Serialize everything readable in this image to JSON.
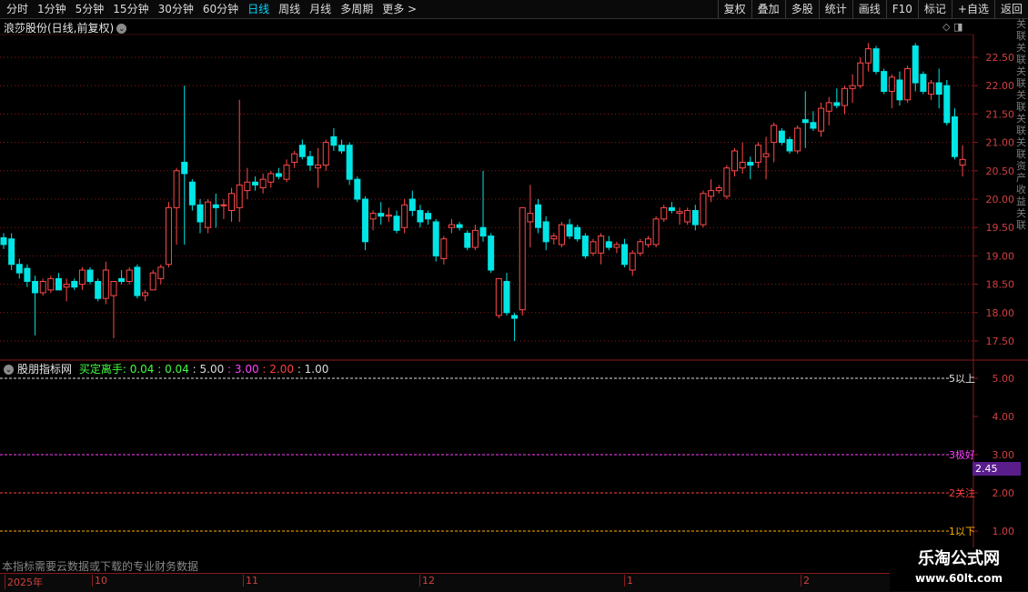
{
  "toolbar": {
    "periods": [
      "分时",
      "1分钟",
      "5分钟",
      "15分钟",
      "30分钟",
      "60分钟",
      "日线",
      "周线",
      "月线",
      "多周期",
      "更多 >"
    ],
    "active_period": "日线",
    "tools": [
      "复权",
      "叠加",
      "多股",
      "统计",
      "画线",
      "F10",
      "标记",
      "+自选",
      "返回"
    ]
  },
  "stock": {
    "title": "浪莎股份(日线,前复权)"
  },
  "main_axis": {
    "ticks": [
      "22.50",
      "22.00",
      "21.50",
      "21.00",
      "20.50",
      "20.00",
      "19.50",
      "19.00",
      "18.50",
      "18.00",
      "17.50"
    ]
  },
  "indicator": {
    "name": "股朋指标网",
    "label": "买定离手:",
    "values": [
      "0.04",
      "0.04",
      "5.00",
      "3.00",
      "2.00",
      "1.00"
    ],
    "value_colors": [
      "#40ff40",
      "#40ff40",
      "#dcdcdc",
      "#ff40ff",
      "#ff4040",
      "#dcdcdc"
    ],
    "axis_ticks": [
      "5.00",
      "4.00",
      "3.00",
      "2.00",
      "1.00"
    ],
    "line_labels": [
      "5以上",
      "3极好",
      "2关注",
      "1以下"
    ],
    "current_value": "2.45"
  },
  "notice": "本指标需要云数据或下载的专业财务数据",
  "time_axis": [
    "2025年",
    "10",
    "11",
    "12",
    "1",
    "2"
  ],
  "watermark": {
    "line1": "乐淘公式网",
    "line2": "www.60lt.com"
  },
  "right_strip_text": "关联关联关联关联关联关联资产收益关联",
  "colors": {
    "up": "#ff4a4a",
    "down": "#00e6e6",
    "grid": "#8b1a1a"
  },
  "chart_data": {
    "type": "candlestick",
    "series": [
      {
        "o": 19.32,
        "h": 19.4,
        "l": 19.12,
        "c": 19.2
      },
      {
        "o": 19.3,
        "h": 19.4,
        "l": 18.75,
        "c": 18.85
      },
      {
        "o": 18.85,
        "h": 18.95,
        "l": 18.6,
        "c": 18.7
      },
      {
        "o": 18.78,
        "h": 18.85,
        "l": 18.45,
        "c": 18.55
      },
      {
        "o": 18.55,
        "h": 18.65,
        "l": 17.6,
        "c": 18.35
      },
      {
        "o": 18.35,
        "h": 18.6,
        "l": 18.3,
        "c": 18.55
      },
      {
        "o": 18.4,
        "h": 18.65,
        "l": 18.35,
        "c": 18.6
      },
      {
        "o": 18.6,
        "h": 18.7,
        "l": 18.45,
        "c": 18.4
      },
      {
        "o": 18.45,
        "h": 18.6,
        "l": 18.2,
        "c": 18.5
      },
      {
        "o": 18.55,
        "h": 18.6,
        "l": 18.4,
        "c": 18.45
      },
      {
        "o": 18.5,
        "h": 18.8,
        "l": 18.4,
        "c": 18.75
      },
      {
        "o": 18.75,
        "h": 18.8,
        "l": 18.5,
        "c": 18.55
      },
      {
        "o": 18.55,
        "h": 18.6,
        "l": 18.2,
        "c": 18.25
      },
      {
        "o": 18.25,
        "h": 18.9,
        "l": 18.15,
        "c": 18.75
      },
      {
        "o": 18.3,
        "h": 18.45,
        "l": 17.55,
        "c": 18.55
      },
      {
        "o": 18.6,
        "h": 18.75,
        "l": 18.5,
        "c": 18.55
      },
      {
        "o": 18.55,
        "h": 18.8,
        "l": 18.5,
        "c": 18.75
      },
      {
        "o": 18.8,
        "h": 18.85,
        "l": 18.25,
        "c": 18.3
      },
      {
        "o": 18.3,
        "h": 18.4,
        "l": 18.2,
        "c": 18.35
      },
      {
        "o": 18.4,
        "h": 18.75,
        "l": 18.4,
        "c": 18.7
      },
      {
        "o": 18.6,
        "h": 18.85,
        "l": 18.5,
        "c": 18.8
      },
      {
        "o": 18.85,
        "h": 19.95,
        "l": 18.8,
        "c": 19.85
      },
      {
        "o": 19.85,
        "h": 20.55,
        "l": 19.2,
        "c": 20.5
      },
      {
        "o": 20.65,
        "h": 22.0,
        "l": 19.2,
        "c": 20.45
      },
      {
        "o": 20.3,
        "h": 20.35,
        "l": 19.8,
        "c": 19.9
      },
      {
        "o": 19.9,
        "h": 20.0,
        "l": 19.4,
        "c": 19.6
      },
      {
        "o": 19.5,
        "h": 20.0,
        "l": 19.4,
        "c": 19.95
      },
      {
        "o": 19.9,
        "h": 20.1,
        "l": 19.5,
        "c": 19.85
      },
      {
        "o": 19.9,
        "h": 20.0,
        "l": 19.65,
        "c": 19.9
      },
      {
        "o": 19.8,
        "h": 20.2,
        "l": 19.6,
        "c": 20.1
      },
      {
        "o": 19.85,
        "h": 21.75,
        "l": 19.6,
        "c": 20.25
      },
      {
        "o": 20.15,
        "h": 20.55,
        "l": 20.0,
        "c": 20.3
      },
      {
        "o": 20.3,
        "h": 20.4,
        "l": 20.15,
        "c": 20.25
      },
      {
        "o": 20.2,
        "h": 20.45,
        "l": 20.1,
        "c": 20.35
      },
      {
        "o": 20.3,
        "h": 20.5,
        "l": 20.2,
        "c": 20.45
      },
      {
        "o": 20.45,
        "h": 20.55,
        "l": 20.35,
        "c": 20.4
      },
      {
        "o": 20.35,
        "h": 20.7,
        "l": 20.3,
        "c": 20.6
      },
      {
        "o": 20.65,
        "h": 20.85,
        "l": 20.55,
        "c": 20.8
      },
      {
        "o": 20.95,
        "h": 21.05,
        "l": 20.7,
        "c": 20.75
      },
      {
        "o": 20.75,
        "h": 20.85,
        "l": 20.5,
        "c": 20.6
      },
      {
        "o": 20.55,
        "h": 20.9,
        "l": 20.2,
        "c": 20.6
      },
      {
        "o": 20.6,
        "h": 21.05,
        "l": 20.5,
        "c": 21.0
      },
      {
        "o": 21.1,
        "h": 21.25,
        "l": 20.85,
        "c": 20.95
      },
      {
        "o": 20.95,
        "h": 21.05,
        "l": 20.8,
        "c": 20.85
      },
      {
        "o": 20.95,
        "h": 21.0,
        "l": 20.25,
        "c": 20.35
      },
      {
        "o": 20.35,
        "h": 20.4,
        "l": 19.95,
        "c": 20.0
      },
      {
        "o": 20.0,
        "h": 20.05,
        "l": 19.1,
        "c": 19.25
      },
      {
        "o": 19.65,
        "h": 19.8,
        "l": 19.45,
        "c": 19.75
      },
      {
        "o": 19.75,
        "h": 19.95,
        "l": 19.55,
        "c": 19.7
      },
      {
        "o": 19.7,
        "h": 19.85,
        "l": 19.6,
        "c": 19.72
      },
      {
        "o": 19.7,
        "h": 19.8,
        "l": 19.4,
        "c": 19.45
      },
      {
        "o": 19.5,
        "h": 20.0,
        "l": 19.4,
        "c": 19.9
      },
      {
        "o": 20.0,
        "h": 20.15,
        "l": 19.7,
        "c": 19.8
      },
      {
        "o": 19.8,
        "h": 19.9,
        "l": 19.5,
        "c": 19.6
      },
      {
        "o": 19.75,
        "h": 19.8,
        "l": 19.55,
        "c": 19.65
      },
      {
        "o": 19.6,
        "h": 19.65,
        "l": 18.9,
        "c": 19.0
      },
      {
        "o": 18.95,
        "h": 19.35,
        "l": 18.85,
        "c": 19.3
      },
      {
        "o": 19.5,
        "h": 19.65,
        "l": 19.4,
        "c": 19.55
      },
      {
        "o": 19.55,
        "h": 19.6,
        "l": 19.45,
        "c": 19.5
      },
      {
        "o": 19.4,
        "h": 19.45,
        "l": 19.1,
        "c": 19.15
      },
      {
        "o": 19.15,
        "h": 19.55,
        "l": 19.1,
        "c": 19.45
      },
      {
        "o": 19.5,
        "h": 20.5,
        "l": 19.25,
        "c": 19.35
      },
      {
        "o": 19.35,
        "h": 19.4,
        "l": 18.7,
        "c": 18.75
      },
      {
        "o": 17.95,
        "h": 18.6,
        "l": 17.9,
        "c": 18.6
      },
      {
        "o": 18.55,
        "h": 18.7,
        "l": 17.95,
        "c": 18.0
      },
      {
        "o": 17.95,
        "h": 18.0,
        "l": 17.5,
        "c": 17.9
      },
      {
        "o": 18.05,
        "h": 19.85,
        "l": 17.95,
        "c": 19.85
      },
      {
        "o": 19.6,
        "h": 20.25,
        "l": 19.15,
        "c": 19.75
      },
      {
        "o": 19.9,
        "h": 20.0,
        "l": 19.4,
        "c": 19.5
      },
      {
        "o": 19.6,
        "h": 19.7,
        "l": 19.1,
        "c": 19.25
      },
      {
        "o": 19.3,
        "h": 19.4,
        "l": 19.2,
        "c": 19.35
      },
      {
        "o": 19.2,
        "h": 19.6,
        "l": 19.15,
        "c": 19.55
      },
      {
        "o": 19.55,
        "h": 19.65,
        "l": 19.3,
        "c": 19.35
      },
      {
        "o": 19.5,
        "h": 19.55,
        "l": 19.25,
        "c": 19.3
      },
      {
        "o": 19.35,
        "h": 19.4,
        "l": 18.95,
        "c": 19.0
      },
      {
        "o": 19.05,
        "h": 19.3,
        "l": 19.0,
        "c": 19.25
      },
      {
        "o": 19.05,
        "h": 19.4,
        "l": 18.85,
        "c": 19.35
      },
      {
        "o": 19.25,
        "h": 19.35,
        "l": 19.1,
        "c": 19.15
      },
      {
        "o": 19.15,
        "h": 19.25,
        "l": 19.05,
        "c": 19.2
      },
      {
        "o": 19.2,
        "h": 19.3,
        "l": 18.8,
        "c": 18.85
      },
      {
        "o": 18.75,
        "h": 19.1,
        "l": 18.65,
        "c": 19.05
      },
      {
        "o": 19.05,
        "h": 19.3,
        "l": 19.0,
        "c": 19.25
      },
      {
        "o": 19.2,
        "h": 19.35,
        "l": 19.15,
        "c": 19.3
      },
      {
        "o": 19.2,
        "h": 19.7,
        "l": 19.15,
        "c": 19.65
      },
      {
        "o": 19.65,
        "h": 19.9,
        "l": 19.6,
        "c": 19.85
      },
      {
        "o": 19.85,
        "h": 19.95,
        "l": 19.75,
        "c": 19.8
      },
      {
        "o": 19.75,
        "h": 19.85,
        "l": 19.55,
        "c": 19.78
      },
      {
        "o": 19.6,
        "h": 19.85,
        "l": 19.55,
        "c": 19.8
      },
      {
        "o": 19.8,
        "h": 19.9,
        "l": 19.45,
        "c": 19.55
      },
      {
        "o": 19.55,
        "h": 20.15,
        "l": 19.5,
        "c": 20.1
      },
      {
        "o": 20.05,
        "h": 20.35,
        "l": 19.95,
        "c": 20.15
      },
      {
        "o": 20.15,
        "h": 20.25,
        "l": 20.1,
        "c": 20.2
      },
      {
        "o": 20.05,
        "h": 20.6,
        "l": 20.0,
        "c": 20.55
      },
      {
        "o": 20.5,
        "h": 20.9,
        "l": 20.4,
        "c": 20.85
      },
      {
        "o": 20.55,
        "h": 21.0,
        "l": 20.45,
        "c": 20.65
      },
      {
        "o": 20.65,
        "h": 20.75,
        "l": 20.35,
        "c": 20.6
      },
      {
        "o": 20.65,
        "h": 21.0,
        "l": 20.55,
        "c": 20.95
      },
      {
        "o": 20.75,
        "h": 21.1,
        "l": 20.35,
        "c": 20.8
      },
      {
        "o": 21.0,
        "h": 21.35,
        "l": 20.65,
        "c": 21.3
      },
      {
        "o": 21.2,
        "h": 21.25,
        "l": 20.95,
        "c": 21.0
      },
      {
        "o": 21.05,
        "h": 21.1,
        "l": 20.8,
        "c": 20.85
      },
      {
        "o": 20.85,
        "h": 21.3,
        "l": 20.8,
        "c": 21.25
      },
      {
        "o": 21.4,
        "h": 21.9,
        "l": 20.9,
        "c": 21.35
      },
      {
        "o": 21.35,
        "h": 21.55,
        "l": 21.2,
        "c": 21.25
      },
      {
        "o": 21.2,
        "h": 21.7,
        "l": 21.1,
        "c": 21.6
      },
      {
        "o": 21.55,
        "h": 21.8,
        "l": 21.3,
        "c": 21.7
      },
      {
        "o": 21.7,
        "h": 21.95,
        "l": 21.6,
        "c": 21.65
      },
      {
        "o": 21.65,
        "h": 22.0,
        "l": 21.5,
        "c": 21.95
      },
      {
        "o": 21.95,
        "h": 22.2,
        "l": 21.7,
        "c": 22.0
      },
      {
        "o": 22.0,
        "h": 22.5,
        "l": 21.95,
        "c": 22.4
      },
      {
        "o": 22.4,
        "h": 22.75,
        "l": 22.25,
        "c": 22.65
      },
      {
        "o": 22.65,
        "h": 22.7,
        "l": 22.2,
        "c": 22.25
      },
      {
        "o": 22.25,
        "h": 22.3,
        "l": 21.85,
        "c": 21.9
      },
      {
        "o": 21.9,
        "h": 22.2,
        "l": 21.6,
        "c": 22.15
      },
      {
        "o": 22.1,
        "h": 22.25,
        "l": 21.65,
        "c": 21.75
      },
      {
        "o": 21.75,
        "h": 22.35,
        "l": 21.7,
        "c": 22.3
      },
      {
        "o": 22.7,
        "h": 22.75,
        "l": 21.9,
        "c": 22.05
      },
      {
        "o": 22.2,
        "h": 22.25,
        "l": 21.85,
        "c": 21.9
      },
      {
        "o": 21.85,
        "h": 22.1,
        "l": 21.75,
        "c": 22.05
      },
      {
        "o": 22.05,
        "h": 22.3,
        "l": 21.6,
        "c": 21.85
      },
      {
        "o": 22.0,
        "h": 22.1,
        "l": 21.3,
        "c": 21.35
      },
      {
        "o": 21.45,
        "h": 21.6,
        "l": 20.7,
        "c": 20.75
      },
      {
        "o": 20.6,
        "h": 20.95,
        "l": 20.4,
        "c": 20.7
      }
    ]
  }
}
